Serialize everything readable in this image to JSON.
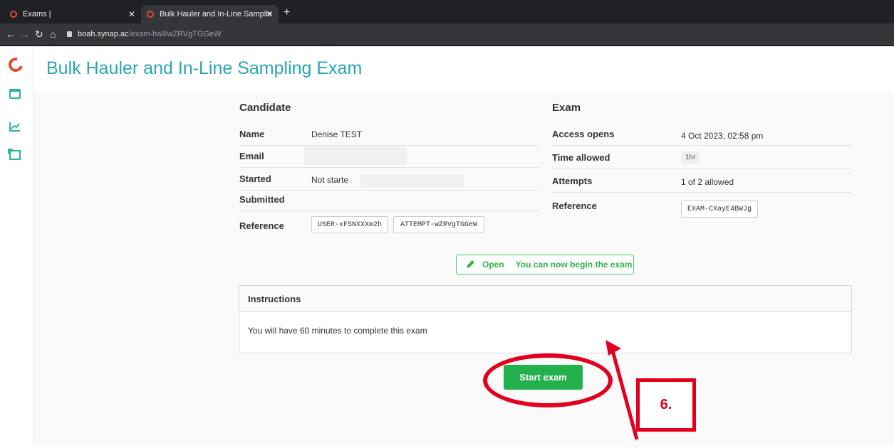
{
  "browser": {
    "tabs": [
      {
        "label": "Exams |"
      },
      {
        "label": "Bulk Hauler and In-Line Samplin"
      }
    ],
    "url_host": "boah.synap.ac",
    "url_path": "/exam-hall/wZRVgTGGeW"
  },
  "page": {
    "title": "Bulk Hauler and In-Line Sampling Exam"
  },
  "candidate": {
    "heading": "Candidate",
    "name_label": "Name",
    "name_value": "Denise TEST",
    "email_label": "Email",
    "started_label": "Started",
    "started_value": "Not starte",
    "submitted_label": "Submitted",
    "reference_label": "Reference",
    "user_ref": "USER-xFSNXXXm2h",
    "attempt_ref": "ATTEMPT-wZRVgTGGeW"
  },
  "exam": {
    "heading": "Exam",
    "access_label": "Access opens",
    "access_value": "4 Oct 2023, 02:58 pm",
    "time_label": "Time allowed",
    "time_value": "1hr",
    "attempts_label": "Attempts",
    "attempts_value": "1 of 2 allowed",
    "reference_label": "Reference",
    "reference_value": "EXAM-CXayE4BWJg"
  },
  "status": {
    "label": "Open",
    "message": "You can now begin the exam"
  },
  "instructions": {
    "heading": "Instructions",
    "body": "You will have 60 minutes to complete this exam"
  },
  "actions": {
    "start_label": "Start exam"
  },
  "annotation": {
    "step": "6."
  },
  "colors": {
    "accent": "#2aa5b5",
    "success": "#22b14c",
    "annotation": "#e1001f"
  }
}
